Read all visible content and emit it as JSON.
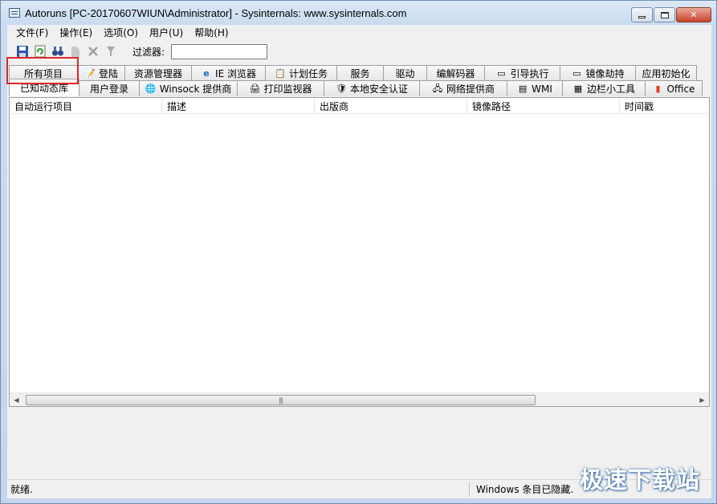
{
  "window": {
    "title": "Autoruns [PC-20170607WIUN\\Administrator] - Sysinternals: www.sysinternals.com"
  },
  "menu": [
    "文件(F)",
    "操作(E)",
    "选项(O)",
    "用户(U)",
    "帮助(H)"
  ],
  "toolbar": {
    "icons": [
      "save-icon",
      "refresh-icon",
      "find-icon",
      "jump-icon",
      "delete-icon",
      "submit-icon"
    ],
    "filter_label": "过滤器:",
    "filter_value": ""
  },
  "tabs_row1": [
    {
      "label": "所有项目",
      "icon": ""
    },
    {
      "label": "登陆",
      "icon": "logon-icon"
    },
    {
      "label": "资源管理器",
      "icon": ""
    },
    {
      "label": "IE 浏览器",
      "icon": "ie-icon"
    },
    {
      "label": "计划任务",
      "icon": "task-icon"
    },
    {
      "label": "服务",
      "icon": ""
    },
    {
      "label": "驱动",
      "icon": ""
    },
    {
      "label": "编解码器",
      "icon": ""
    },
    {
      "label": "引导执行",
      "icon": "window-icon"
    },
    {
      "label": "镜像劫持",
      "icon": "window-icon"
    },
    {
      "label": "应用初始化",
      "icon": ""
    }
  ],
  "tabs_row2": [
    {
      "label": "已知动态库",
      "icon": ""
    },
    {
      "label": "用户登录",
      "icon": ""
    },
    {
      "label": "Winsock 提供商",
      "icon": "globe-icon"
    },
    {
      "label": "打印监视器",
      "icon": "printer-icon"
    },
    {
      "label": "本地安全认证",
      "icon": "shield-icon"
    },
    {
      "label": "网络提供商",
      "icon": "network-icon"
    },
    {
      "label": "WMI",
      "icon": "wmi-icon"
    },
    {
      "label": "边栏小工具",
      "icon": "gadget-icon"
    },
    {
      "label": "Office",
      "icon": "office-icon"
    }
  ],
  "columns": [
    "自动运行项目",
    "描述",
    "出版商",
    "镜像路径",
    "时间戳"
  ],
  "status": {
    "left": "就绪.",
    "right": "Windows 条目已隐藏."
  },
  "watermark": "极速下载站"
}
